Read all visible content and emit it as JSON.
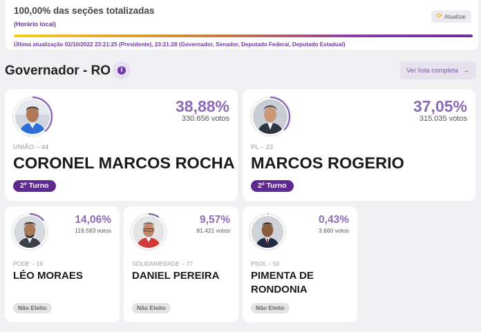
{
  "status": {
    "title": "100,00% das seções totalizadas",
    "subtitle": "(Horário local)",
    "refresh_label": "Atualizar",
    "progress_fraction": 1.0,
    "last_update": "Última atualização 02/10/2022 23:21:25 (Presidente), 23:21:28 (Governador, Senador, Deputado Federal, Deputado Estadual)"
  },
  "section": {
    "title": "Governador - RO",
    "info_glyph": "i",
    "list_button_label": "Ver lista completa",
    "list_button_arrow": "→"
  },
  "candidates": [
    {
      "percent": "38,88%",
      "votes": "330.656 votos",
      "party": "UNIÃO – 44",
      "name": "CORONEL MARCOS ROCHA",
      "status": "2º Turno",
      "share": 0.3888
    },
    {
      "percent": "37,05%",
      "votes": "315.035 votos",
      "party": "PL – 22",
      "name": "MARCOS ROGERIO",
      "status": "2º Turno",
      "share": 0.3705
    },
    {
      "percent": "14,06%",
      "votes": "119.583 votos",
      "party": "PODE – 19",
      "name": "LÉO MORAES",
      "status": "Não Eleito",
      "share": 0.1406
    },
    {
      "percent": "9,57%",
      "votes": "81.421 votos",
      "party": "SOLIDARIEDADE – 77",
      "name": "DANIEL PEREIRA",
      "status": "Não Eleito",
      "share": 0.0957
    },
    {
      "percent": "0,43%",
      "votes": "3.660 votos",
      "party": "PSOL – 50",
      "name": "PIMENTA DE RONDONIA",
      "status": "Não Eleito",
      "share": 0.0043
    }
  ],
  "colors": {
    "accent": "#6f3aa8",
    "percent": "#8c6ab8",
    "badge_second_round": "#5f2a90",
    "badge_not_elected": "#e3e3e3"
  }
}
